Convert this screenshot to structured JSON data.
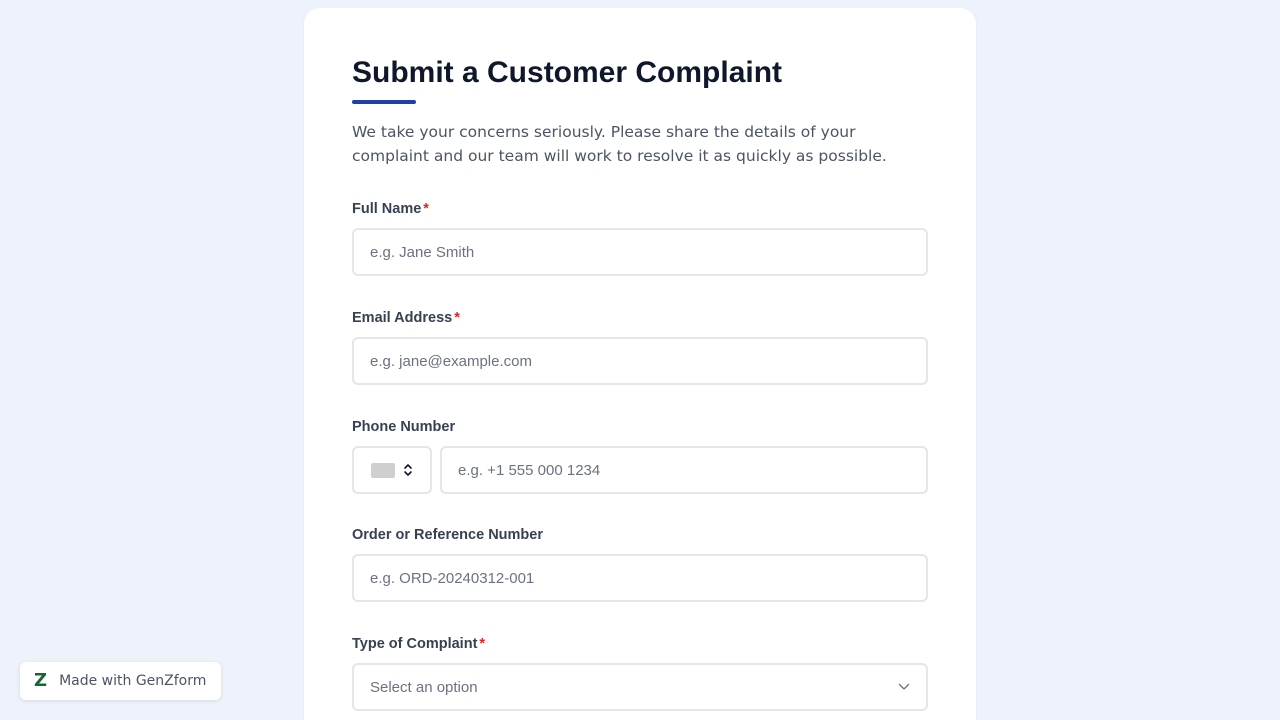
{
  "form": {
    "title": "Submit a Customer Complaint",
    "intro": "We take your concerns seriously. Please share the details of your complaint and our team will work to resolve it as quickly as possible.",
    "required_marker": "*",
    "fields": {
      "full_name": {
        "label": "Full Name",
        "placeholder": "e.g. Jane Smith",
        "value": ""
      },
      "email": {
        "label": "Email Address",
        "placeholder": "e.g. jane@example.com",
        "value": ""
      },
      "phone": {
        "label": "Phone Number",
        "placeholder": "e.g. +1 555 000 1234",
        "value": ""
      },
      "order_ref": {
        "label": "Order or Reference Number",
        "placeholder": "e.g. ORD-20240312-001",
        "value": ""
      },
      "complaint_type": {
        "label": "Type of Complaint",
        "placeholder": "Select an option"
      }
    }
  },
  "badge": {
    "logo": "Z",
    "text": "Made with GenZform"
  },
  "colors": {
    "background": "#eef3fb",
    "accent": "#1e40af",
    "required": "#dc2626",
    "badge_logo": "#166534"
  },
  "icons": {
    "country_flag": "flag-placeholder-icon",
    "country_toggle": "chevron-up-down-icon",
    "select_toggle": "chevron-down-icon"
  }
}
